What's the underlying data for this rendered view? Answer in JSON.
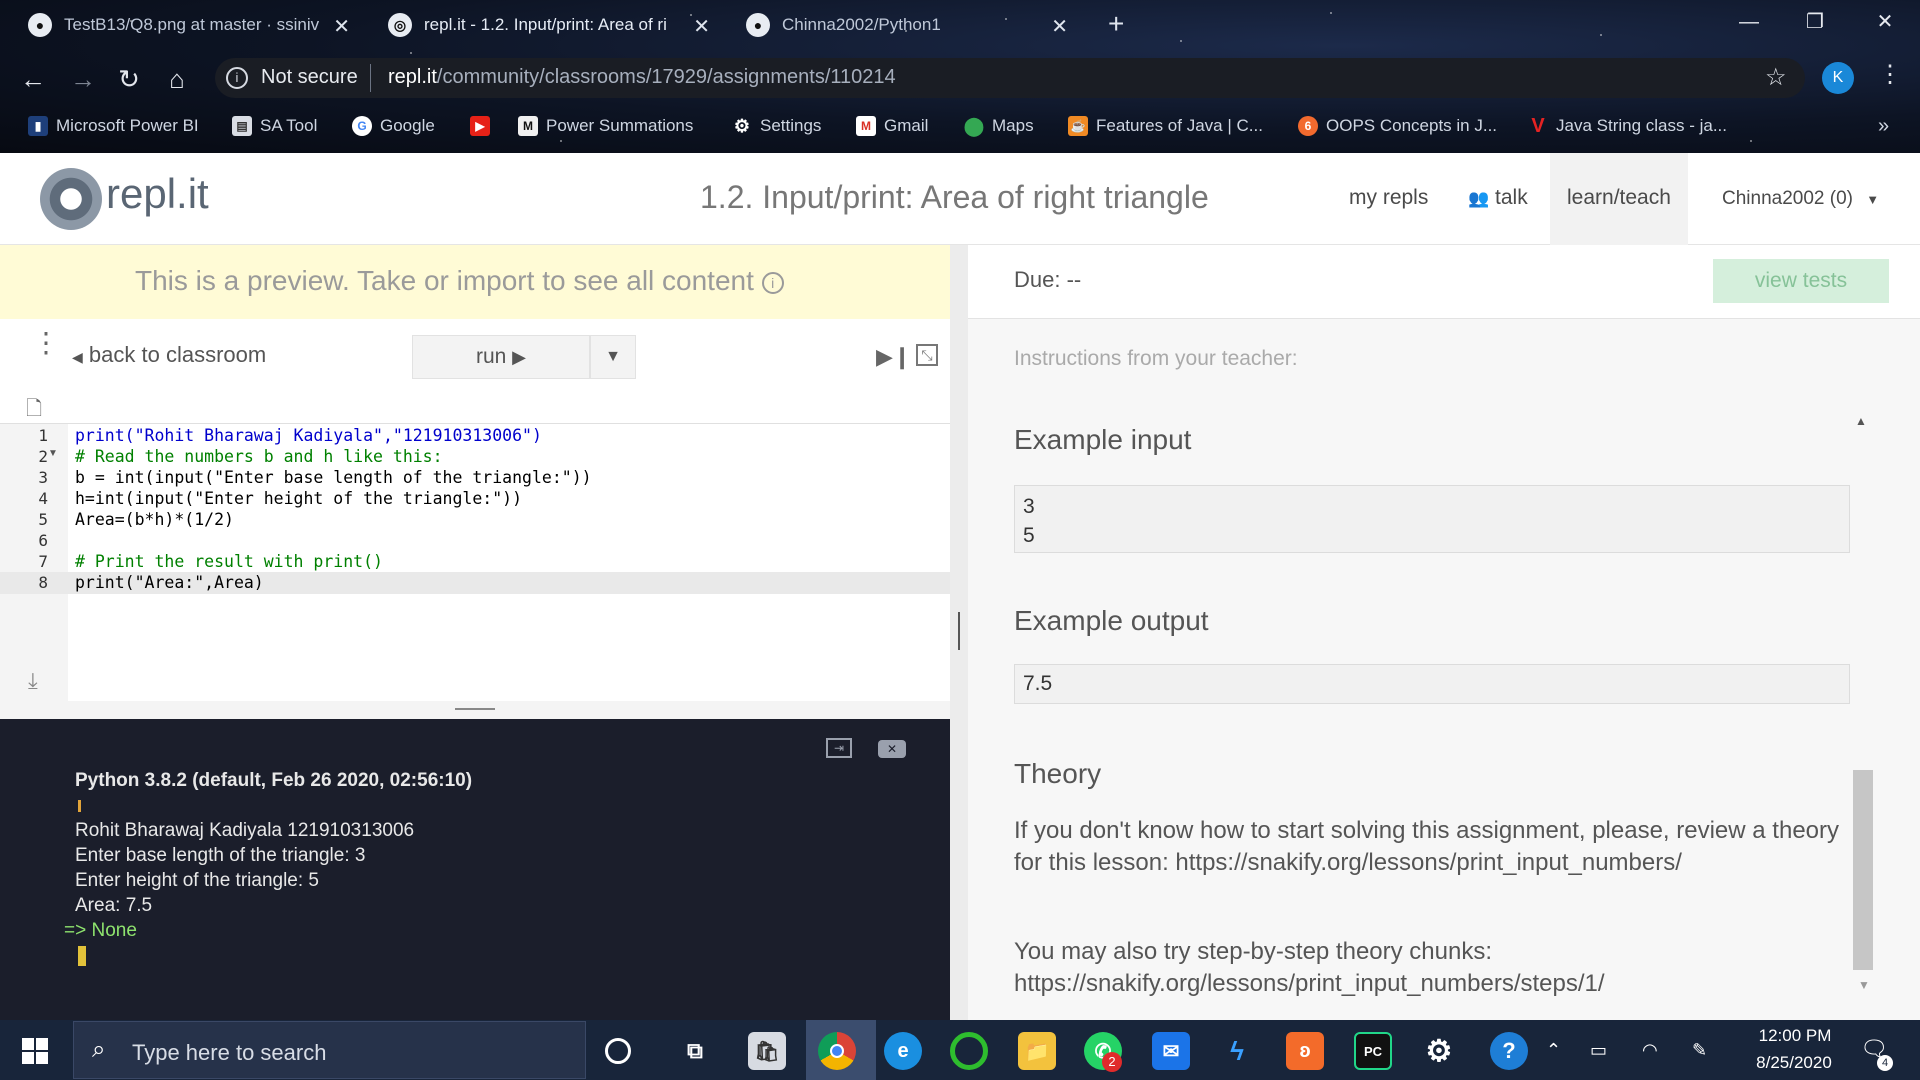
{
  "browser": {
    "tabs": [
      {
        "title": "TestB13/Q8.png at master · ssiniv"
      },
      {
        "title": "repl.it - 1.2. Input/print: Area of ri"
      },
      {
        "title": "Chinna2002/Python1"
      }
    ],
    "security_label": "Not secure",
    "url_domain": "repl.it",
    "url_path": "/community/classrooms/17929/assignments/110214",
    "profile_initial": "K",
    "bookmarks": [
      {
        "label": "Microsoft Power BI",
        "icon": "power-bi-icon"
      },
      {
        "label": "SA Tool",
        "icon": "doc-icon"
      },
      {
        "label": "Google",
        "icon": "google-icon"
      },
      {
        "label": "",
        "icon": "youtube-icon"
      },
      {
        "label": "Power Summations",
        "icon": "m-icon"
      },
      {
        "label": "Settings",
        "icon": "gear-icon"
      },
      {
        "label": "Gmail",
        "icon": "gmail-icon"
      },
      {
        "label": "Maps",
        "icon": "maps-icon"
      },
      {
        "label": "Features of Java | C...",
        "icon": "java-icon"
      },
      {
        "label": "OOPS Concepts in J...",
        "icon": "oops-icon"
      },
      {
        "label": "Java String class - ja...",
        "icon": "v-icon"
      }
    ],
    "more_bookmarks": "»"
  },
  "header": {
    "logo_text": "repl.it",
    "assignment_title": "1.2. Input/print: Area of right triangle",
    "nav": {
      "my_repls": "my repls",
      "talk": "talk",
      "learn_teach": "learn/teach",
      "user": "Chinna2002 (0)"
    }
  },
  "left": {
    "preview_text": "This is a preview. Take or import to see all content",
    "back_label": "back to classroom",
    "run_label": "run",
    "code_lines": [
      "print(\"Rohit Bharawaj Kadiyala\",\"121910313006\")",
      "# Read the numbers b and h like this:",
      "b = int(input(\"Enter base length of the triangle:\"))",
      "h=int(input(\"Enter height of the triangle:\"))",
      "Area=(b*h)*(1/2)",
      "",
      "# Print the result with print()",
      "print(\"Area:\",Area)"
    ],
    "console": {
      "header": "Python 3.8.2 (default, Feb 26 2020, 02:56:10)",
      "lines": [
        "Rohit Bharawaj Kadiyala 121910313006",
        "Enter base length of the triangle: 3",
        "Enter height of the triangle: 5",
        "Area: 7.5"
      ],
      "result": "=> None"
    }
  },
  "right": {
    "due": "Due: --",
    "view_tests": "view tests",
    "instructions_label": "Instructions from your teacher:",
    "example_input_title": "Example input",
    "example_input": "3\n5",
    "example_output_title": "Example output",
    "example_output": "7.5",
    "theory_title": "Theory",
    "theory_p1": "If you don't know how to start solving this assignment, please, review a theory for this lesson: https://snakify.org/lessons/print_input_numbers/",
    "theory_p2": "You may also try step-by-step theory chunks: https://snakify.org/lessons/print_input_numbers/steps/1/"
  },
  "taskbar": {
    "search_placeholder": "Type here to search",
    "time": "12:00 PM",
    "date": "8/25/2020",
    "notification_count": "4",
    "whatsapp_badge": "2"
  }
}
